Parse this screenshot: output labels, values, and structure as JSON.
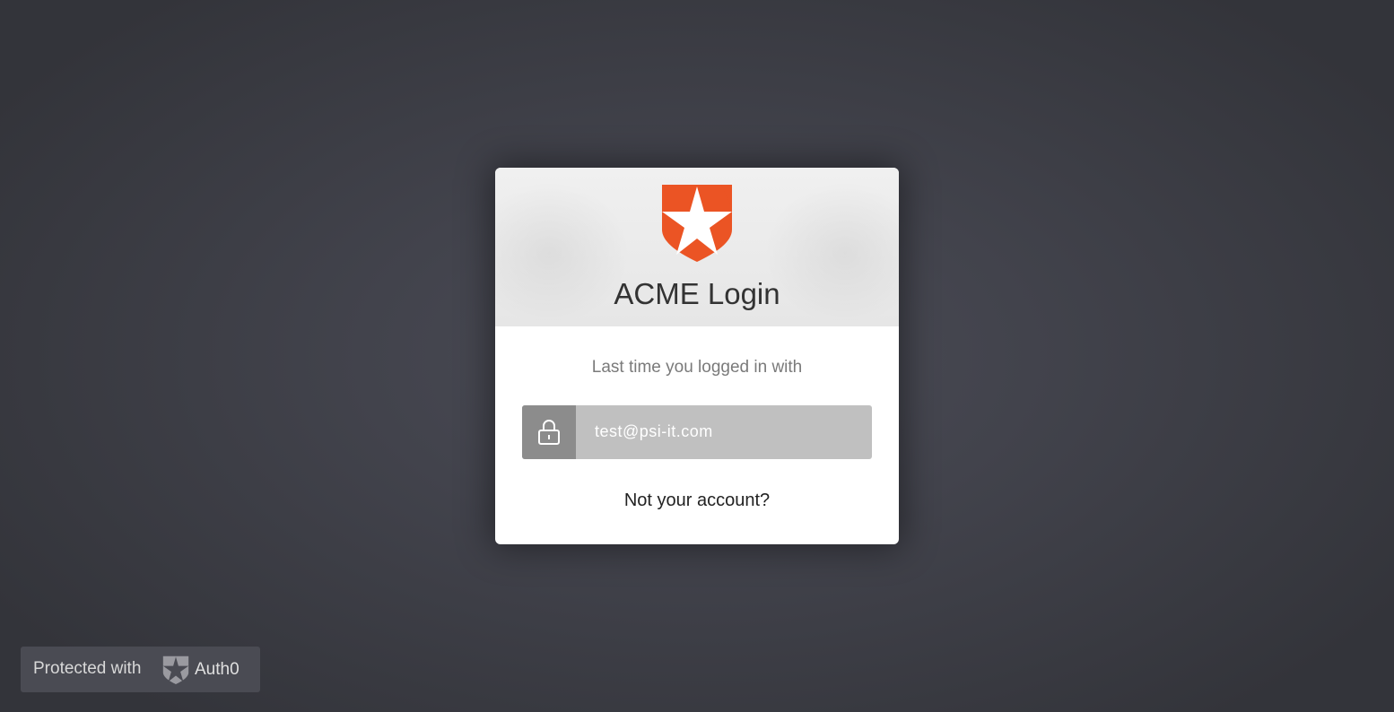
{
  "login": {
    "title": "ACME Login",
    "subtitle": "Last time you logged in with",
    "last_account": "test@psi-it.com",
    "not_your_account": "Not your account?",
    "logo": "auth0-shield-star-icon",
    "brand_color": "#eb5424"
  },
  "badge": {
    "protected_text": "Protected with",
    "brand": "Auth0",
    "logo": "auth0-shield-star-icon"
  },
  "icons": {
    "account": "lock-icon"
  }
}
